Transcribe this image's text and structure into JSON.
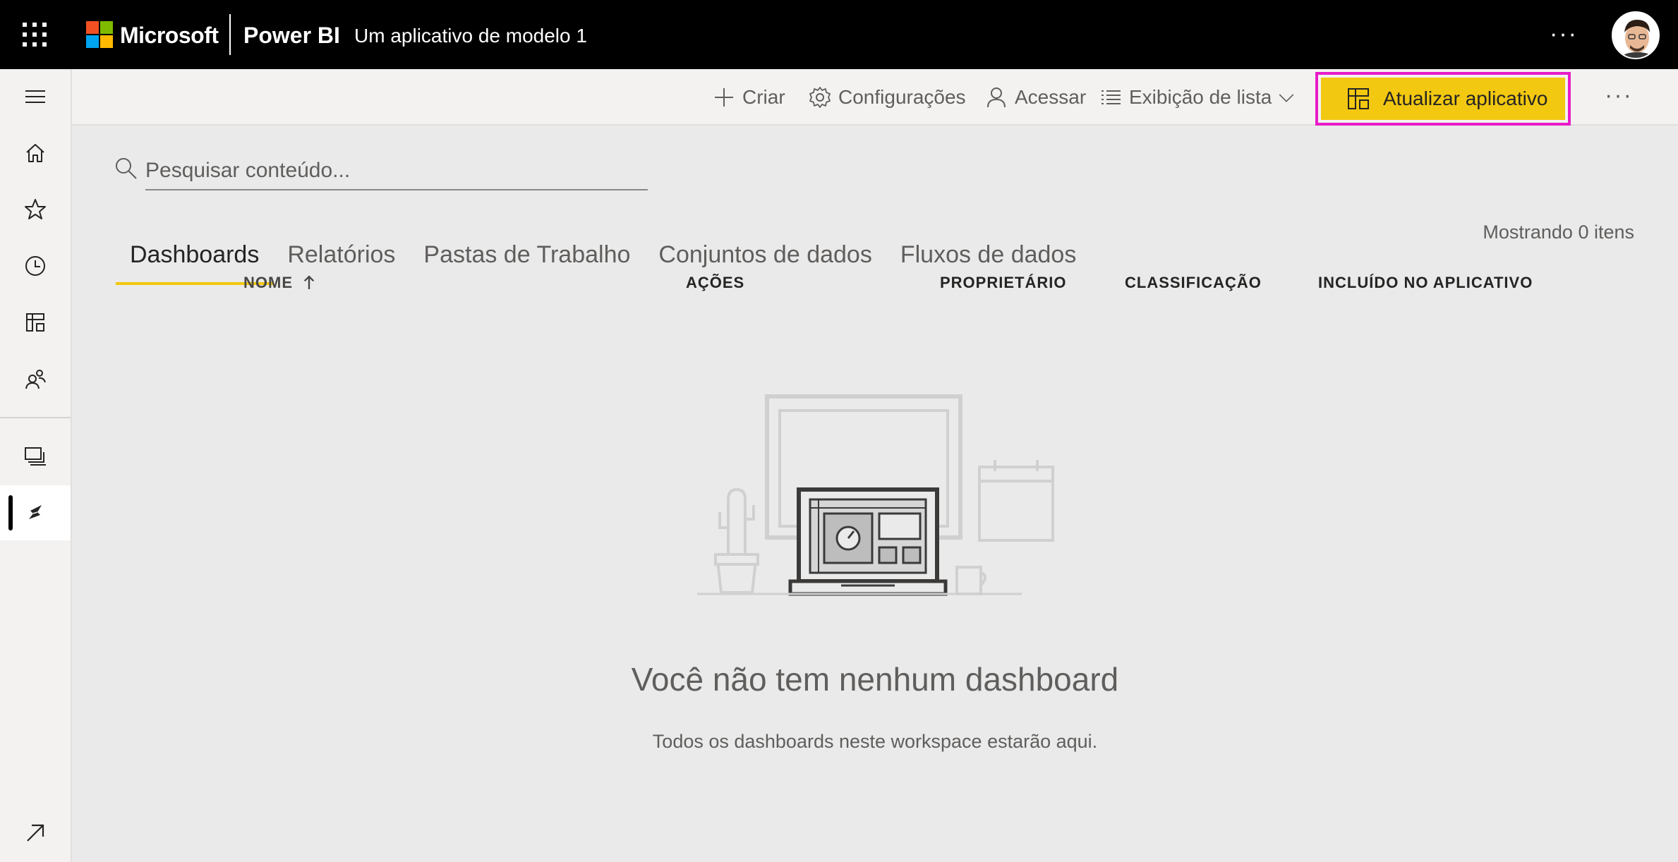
{
  "header": {
    "brand": "Microsoft",
    "product": "Power BI",
    "app_title": "Um aplicativo de modelo 1",
    "more": "···",
    "ms_colors": [
      "#f25022",
      "#7fba00",
      "#00a4ef",
      "#ffb900"
    ]
  },
  "leftnav": {
    "items": [
      "hamburger-icon",
      "home-icon",
      "star-icon",
      "clock-icon",
      "apps-icon",
      "people-icon",
      "workspaces-icon",
      "app-workspace-icon",
      "expand-icon"
    ],
    "active": "app-workspace-icon"
  },
  "toolbar": {
    "create_label": "Criar",
    "settings_label": "Configurações",
    "access_label": "Acessar",
    "list_view_label": "Exibição de lista",
    "update_app_label": "Atualizar aplicativo",
    "more": "···",
    "accent_color": "#f2c811",
    "highlight_color": "#e81bc9"
  },
  "search": {
    "placeholder": "Pesquisar conteúdo..."
  },
  "content": {
    "count_label": "Mostrando 0 itens",
    "tabs": [
      {
        "label": "Dashboards",
        "active": true
      },
      {
        "label": "Relatórios",
        "active": false
      },
      {
        "label": "Pastas de Trabalho",
        "active": false
      },
      {
        "label": "Conjuntos de dados",
        "active": false
      },
      {
        "label": "Fluxos de dados",
        "active": false
      }
    ],
    "columns": [
      "NOME",
      "AÇÕES",
      "PROPRIETÁRIO",
      "CLASSIFICAÇÃO",
      "INCLUÍDO NO APLICATIVO"
    ],
    "sort_column": "NOME",
    "sort_direction": "ascending",
    "empty_title": "Você não tem nenhum dashboard",
    "empty_subtitle": "Todos os dashboards neste workspace estarão aqui."
  }
}
